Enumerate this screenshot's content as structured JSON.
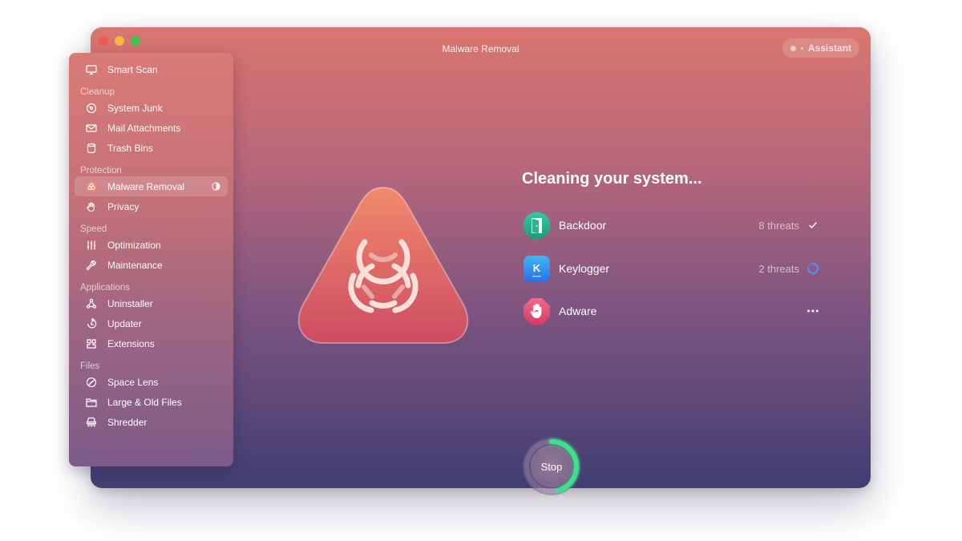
{
  "window": {
    "title": "Malware Removal",
    "assistant_label": "Assistant"
  },
  "sidebar": {
    "top_item": {
      "label": "Smart Scan",
      "icon": "monitor-icon"
    },
    "sections": [
      {
        "header": "Cleanup",
        "items": [
          {
            "label": "System Junk",
            "icon": "disk-icon"
          },
          {
            "label": "Mail Attachments",
            "icon": "mail-icon"
          },
          {
            "label": "Trash Bins",
            "icon": "trash-icon"
          }
        ]
      },
      {
        "header": "Protection",
        "items": [
          {
            "label": "Malware Removal",
            "icon": "biohazard-icon",
            "active": true
          },
          {
            "label": "Privacy",
            "icon": "hand-icon"
          }
        ]
      },
      {
        "header": "Speed",
        "items": [
          {
            "label": "Optimization",
            "icon": "sliders-icon"
          },
          {
            "label": "Maintenance",
            "icon": "wrench-icon"
          }
        ]
      },
      {
        "header": "Applications",
        "items": [
          {
            "label": "Uninstaller",
            "icon": "uninstaller-icon"
          },
          {
            "label": "Updater",
            "icon": "updater-icon"
          },
          {
            "label": "Extensions",
            "icon": "extensions-icon"
          }
        ]
      },
      {
        "header": "Files",
        "items": [
          {
            "label": "Space Lens",
            "icon": "lens-icon"
          },
          {
            "label": "Large & Old Files",
            "icon": "folder-icon"
          },
          {
            "label": "Shredder",
            "icon": "shredder-icon"
          }
        ]
      }
    ]
  },
  "main": {
    "heading": "Cleaning your system...",
    "threats": [
      {
        "name": "Backdoor",
        "count": "8 threats",
        "status": "done",
        "icon": "backdoor-icon"
      },
      {
        "name": "Keylogger",
        "count": "2 threats",
        "status": "in-progress",
        "icon": "keylogger-icon",
        "icon_letter": "K"
      },
      {
        "name": "Adware",
        "count": "",
        "status": "pending",
        "icon": "adware-icon"
      }
    ],
    "stop_label": "Stop",
    "progress": 0.45
  },
  "colors": {
    "progress_ring": "#3ee08a",
    "spinner": "#4a90ff",
    "hero_top": "#f0876a",
    "hero_bottom": "#cf4f63"
  }
}
